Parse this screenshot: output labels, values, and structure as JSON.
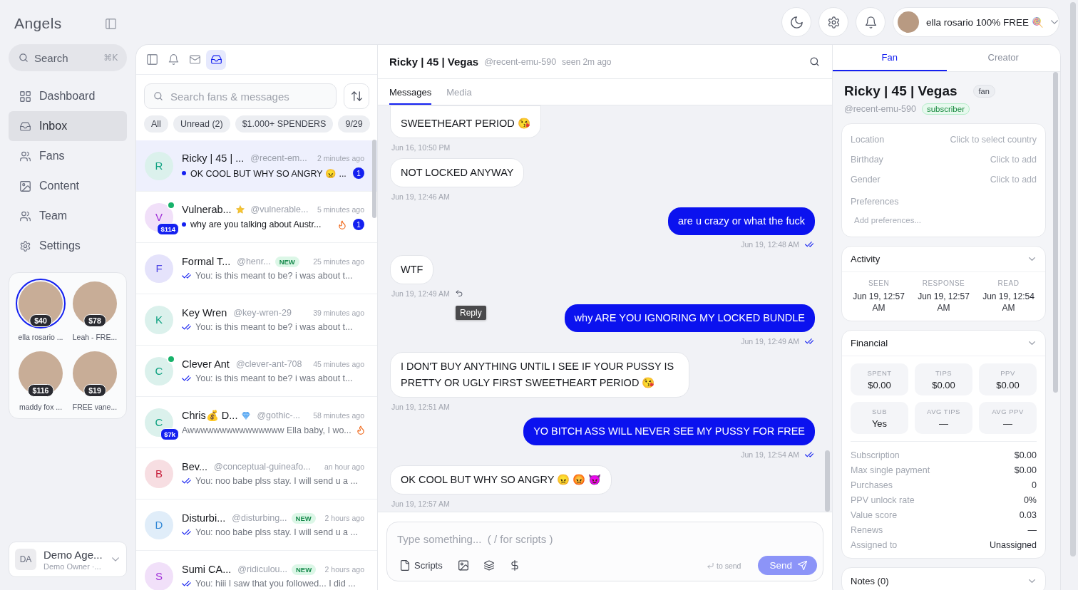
{
  "sidebar": {
    "logo": "Angels",
    "search": {
      "placeholder": "Search",
      "shortcut": "⌘K"
    },
    "nav": [
      {
        "kind": "dashboard",
        "label": "Dashboard",
        "selected": false
      },
      {
        "kind": "inbox",
        "label": "Inbox",
        "selected": true
      },
      {
        "kind": "fans",
        "label": "Fans",
        "selected": false
      },
      {
        "kind": "content",
        "label": "Content",
        "selected": false
      },
      {
        "kind": "team",
        "label": "Team",
        "selected": false
      },
      {
        "kind": "settings",
        "label": "Settings",
        "selected": false
      }
    ],
    "creators": [
      {
        "name": "ella rosario ...",
        "earnings": "$40",
        "selected": true
      },
      {
        "name": "Leah - FRE...",
        "earnings": "$78",
        "selected": false
      },
      {
        "name": "maddy fox ...",
        "earnings": "$116",
        "selected": false
      },
      {
        "name": "FREE vane...",
        "earnings": "$19",
        "selected": false
      }
    ],
    "account": {
      "initials": "DA",
      "name": "Demo Age...",
      "role": "Demo Owner ·..."
    }
  },
  "topbar": {
    "buttons": [
      {
        "kind": "theme"
      },
      {
        "kind": "settings"
      },
      {
        "kind": "notifications"
      }
    ],
    "profile": {
      "name": "ella rosario 100% FREE 🍭"
    }
  },
  "inbox": {
    "views": [
      {
        "kind": "panel",
        "selected": false
      },
      {
        "kind": "notifications",
        "selected": false
      },
      {
        "kind": "mail",
        "selected": false
      },
      {
        "kind": "inbox",
        "selected": true
      }
    ],
    "search": {
      "placeholder": "Search fans & messages"
    },
    "filters": [
      {
        "label": "All",
        "selected": false
      },
      {
        "label": "Unread (2)",
        "selected": false
      },
      {
        "label": "$1.000+ SPENDERS",
        "selected": false
      },
      {
        "label": "9/29",
        "selected": false
      }
    ],
    "conversations": [
      {
        "initial": "R",
        "color": "#12a383",
        "name": "Ricky | 45 | ...",
        "handle": "@recent-em...",
        "time": "2 minutes ago",
        "unread": true,
        "preview": "OK COOL BUT WHY SO ANGRY 😠 ...",
        "unread_count": "1",
        "selected": true
      },
      {
        "initial": "V",
        "color": "#a030d8",
        "online": true,
        "spend": "$114",
        "name": "Vulnerab...",
        "star": true,
        "handle": "@vulnerable...",
        "time": "5 minutes ago",
        "unread": true,
        "preview": "why are you talking about Austr...",
        "hot": true,
        "unread_count": "1",
        "selected": false
      },
      {
        "initial": "F",
        "color": "#4f46e5",
        "name": "Formal T...",
        "handle": "@henr...",
        "tag": "NEW",
        "time": "25 minutes ago",
        "read": true,
        "preview": "You: is this meant to be? i was about t...",
        "selected": false
      },
      {
        "initial": "K",
        "color": "#12a383",
        "name": "Key Wren",
        "handle": "@key-wren-29",
        "time": "39 minutes ago",
        "read": true,
        "preview": "You: is this meant to be? i was about t...",
        "selected": false
      },
      {
        "initial": "C",
        "color": "#12a383",
        "online": true,
        "name": "Clever Ant",
        "handle": "@clever-ant-708",
        "time": "45 minutes ago",
        "read": true,
        "preview": "You: is this meant to be? i was about t...",
        "selected": false
      },
      {
        "initial": "C",
        "color": "#12a383",
        "spend": "$7k",
        "name": "Chris💰 D...",
        "diamond": true,
        "handle": "@gothic-...",
        "time": "58 minutes ago",
        "preview": "Awwwwwwwwwwwwwww Ella baby, I wo...",
        "hot": true,
        "selected": false
      },
      {
        "initial": "B",
        "color": "#c8233f",
        "name": "Bev...",
        "handle": "@conceptual-guineafo...",
        "time": "an hour ago",
        "read": true,
        "preview": "You: noo babe plss stay. I will send u a ...",
        "selected": false
      },
      {
        "initial": "D",
        "color": "#2f86d6",
        "name": "Disturbi...",
        "handle": "@disturbing...",
        "tag": "NEW",
        "time": "2 hours ago",
        "read": true,
        "preview": "You: noo babe plss stay. I will send u a ...",
        "selected": false
      },
      {
        "initial": "S",
        "color": "#a030d8",
        "name": "Sumi CA...",
        "handle": "@ridiculou...",
        "tag": "NEW",
        "time": "2 hours ago",
        "read": true,
        "preview": "You: hiii I saw that you followed... I did ...",
        "selected": false
      }
    ]
  },
  "chat": {
    "header": {
      "name": "Ricky | 45 | Vegas",
      "handle": "@recent-emu-590",
      "seen": "seen 2m ago"
    },
    "tabs": [
      {
        "label": "Messages",
        "selected": true
      },
      {
        "label": "Media",
        "selected": false
      }
    ],
    "messages": [
      {
        "kind": "received",
        "cut": true,
        "text": "SWEETHEART PERIOD 😘",
        "time": "Jun 16, 10:50 PM"
      },
      {
        "kind": "received",
        "text": "NOT LOCKED ANYWAY",
        "time": "Jun 19, 12:46 AM"
      },
      {
        "kind": "sent",
        "text": "are u crazy or what the fuck",
        "time": "Jun 19, 12:48 AM",
        "read": true
      },
      {
        "kind": "received",
        "text": "WTF",
        "time": "Jun 19, 12:49 AM",
        "reply_tooltip": "Reply"
      },
      {
        "kind": "sent",
        "text": "why ARE YOU IGNORING MY LOCKED BUNDLE",
        "time": "Jun 19, 12:49 AM",
        "read": true
      },
      {
        "kind": "received",
        "text": "I DON'T BUY ANYTHING UNTIL I SEE IF YOUR PUSSY IS PRETTY OR UGLY FIRST SWEETHEART PERIOD 😘",
        "time": "Jun 19, 12:51 AM"
      },
      {
        "kind": "sent",
        "text": "YO BITCH ASS WILL NEVER SEE MY PUSSY FOR FREE",
        "time": "Jun 19, 12:54 AM",
        "read": true
      },
      {
        "kind": "received",
        "text": "OK COOL BUT WHY SO ANGRY 😠 😡 😈",
        "time": "Jun 19, 12:57 AM"
      }
    ],
    "compose": {
      "placeholder": "Type something...  ( / for scripts )",
      "tools": [
        {
          "kind": "scripts",
          "label": "Scripts"
        },
        {
          "kind": "image"
        },
        {
          "kind": "bundle"
        },
        {
          "kind": "price"
        }
      ],
      "hint": "to send",
      "send": {
        "label": "Send",
        "disabled": true
      }
    }
  },
  "fan_panel": {
    "tabs": [
      {
        "label": "Fan",
        "selected": true
      },
      {
        "label": "Creator",
        "selected": false
      }
    ],
    "name": "Ricky | 45 | Vegas",
    "role": "fan",
    "handle": "@recent-emu-590",
    "status": "subscriber",
    "details": [
      {
        "label": "Location",
        "value": "Click to select country"
      },
      {
        "label": "Birthday",
        "value": "Click to add"
      },
      {
        "label": "Gender",
        "value": "Click to add"
      }
    ],
    "preferences": {
      "label": "Preferences",
      "placeholder": "Add preferences..."
    },
    "activity": {
      "title": "Activity",
      "stats": [
        {
          "label": "SEEN",
          "value": "Jun 19, 12:57 AM"
        },
        {
          "label": "RESPONSE",
          "value": "Jun 19, 12:57 AM"
        },
        {
          "label": "READ",
          "value": "Jun 19, 12:54 AM"
        }
      ]
    },
    "financial": {
      "title": "Financial",
      "tiles": [
        {
          "label": "SPENT",
          "value": "$0.00"
        },
        {
          "label": "TIPS",
          "value": "$0.00"
        },
        {
          "label": "PPV",
          "value": "$0.00"
        },
        {
          "label": "SUB",
          "value": "Yes"
        },
        {
          "label": "AVG TIPS",
          "value": "—"
        },
        {
          "label": "AVG PPV",
          "value": "—"
        }
      ],
      "rows": [
        {
          "label": "Subscription",
          "value": "$0.00"
        },
        {
          "label": "Max single payment",
          "value": "$0.00"
        },
        {
          "label": "Purchases",
          "value": "0"
        },
        {
          "label": "PPV unlock rate",
          "value": "0%"
        },
        {
          "label": "Value score",
          "value": "0.03"
        },
        {
          "label": "Renews",
          "value": "—"
        },
        {
          "label": "Assigned to",
          "value": "Unassigned"
        }
      ]
    },
    "notes": {
      "title": "Notes (0)"
    }
  }
}
